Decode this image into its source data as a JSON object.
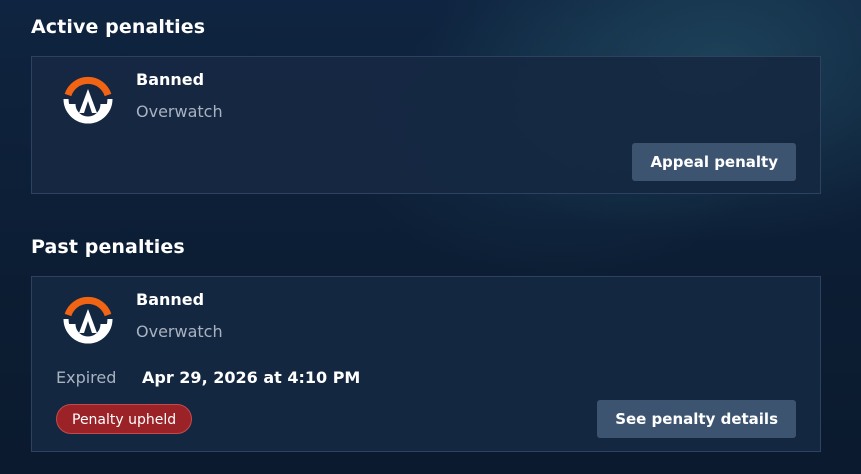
{
  "active": {
    "heading": "Active penalties",
    "penalty": {
      "type": "Banned",
      "game": "Overwatch",
      "logo_icon": "overwatch-logo-icon",
      "action_label": "Appeal penalty"
    }
  },
  "past": {
    "heading": "Past penalties",
    "penalty": {
      "type": "Banned",
      "game": "Overwatch",
      "logo_icon": "overwatch-logo-icon",
      "expired_label": "Expired",
      "expired_date": "Apr 29, 2026 at 4:10 PM",
      "status": "Penalty upheld",
      "action_label": "See penalty details"
    }
  },
  "colors": {
    "background": "#0d1f35",
    "card": "#16283f",
    "button": "#3d5470",
    "badge": "#9b2226",
    "logo_orange": "#f06414"
  }
}
